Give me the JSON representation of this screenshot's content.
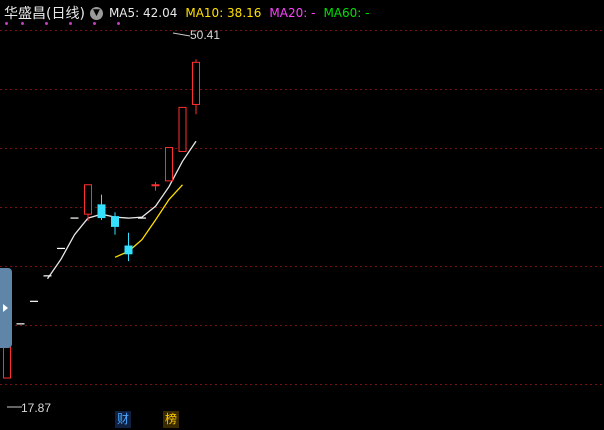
{
  "stock": {
    "name": "华盛昌",
    "period": "(日线)"
  },
  "legend": {
    "ma5_label": "MA5: 42.04",
    "ma10_label": "MA10: 38.16",
    "ma20_label": "MA20: -",
    "ma60_label": "MA60: -"
  },
  "colors": {
    "background": "#000000",
    "up": "#ff3030",
    "down": "#35e0ff",
    "ma5": "#e8e8e8",
    "ma10": "#ffe000",
    "ma20": "#ff40ff",
    "ma60": "#00e000",
    "grid": "#7a1010"
  },
  "markers": {
    "financial": "财",
    "ranking": "榜"
  },
  "annotations": {
    "high_label": "50.41",
    "low_label": "17.87"
  },
  "chart_data": {
    "type": "candlestick",
    "y_range": [
      14.3,
      53.4
    ],
    "grid": "dashed horizontal",
    "high": 50.41,
    "low": 17.87,
    "candles": [
      {
        "o": 17.87,
        "h": 21.3,
        "l": 17.87,
        "c": 21.3
      },
      {
        "o": 23.4,
        "h": 23.4,
        "l": 23.4,
        "c": 23.4
      },
      {
        "o": 25.7,
        "h": 25.7,
        "l": 25.7,
        "c": 25.7
      },
      {
        "o": 28.3,
        "h": 28.3,
        "l": 28.3,
        "c": 28.3
      },
      {
        "o": 31.1,
        "h": 31.1,
        "l": 31.1,
        "c": 31.1
      },
      {
        "o": 34.2,
        "h": 34.2,
        "l": 34.2,
        "c": 34.2
      },
      {
        "o": 34.6,
        "h": 37.6,
        "l": 33.9,
        "c": 37.6
      },
      {
        "o": 35.6,
        "h": 36.6,
        "l": 34.0,
        "c": 34.2
      },
      {
        "o": 34.4,
        "h": 34.8,
        "l": 32.5,
        "c": 33.3
      },
      {
        "o": 31.4,
        "h": 32.7,
        "l": 29.8,
        "c": 30.5
      },
      {
        "o": 34.2,
        "h": 34.2,
        "l": 34.2,
        "c": 34.2
      },
      {
        "o": 37.6,
        "h": 37.9,
        "l": 37.0,
        "c": 37.6
      },
      {
        "o": 38.0,
        "h": 41.4,
        "l": 38.0,
        "c": 41.4
      },
      {
        "o": 41.0,
        "h": 45.5,
        "l": 41.0,
        "c": 45.5
      },
      {
        "o": 45.8,
        "h": 50.41,
        "l": 44.8,
        "c": 50.1
      }
    ],
    "ma5": [
      [
        3,
        28.0
      ],
      [
        4,
        30.0
      ],
      [
        5,
        32.5
      ],
      [
        6,
        34.2
      ],
      [
        7,
        34.6
      ],
      [
        8,
        34.3
      ],
      [
        9,
        34.2
      ],
      [
        10,
        34.3
      ],
      [
        11,
        35.4
      ],
      [
        12,
        37.4
      ],
      [
        13,
        40.0
      ],
      [
        14,
        42.04
      ]
    ],
    "ma10": [
      [
        8,
        30.2
      ],
      [
        9,
        30.8
      ],
      [
        10,
        32.0
      ],
      [
        11,
        34.0
      ],
      [
        12,
        36.1
      ],
      [
        13,
        37.6
      ]
    ]
  }
}
